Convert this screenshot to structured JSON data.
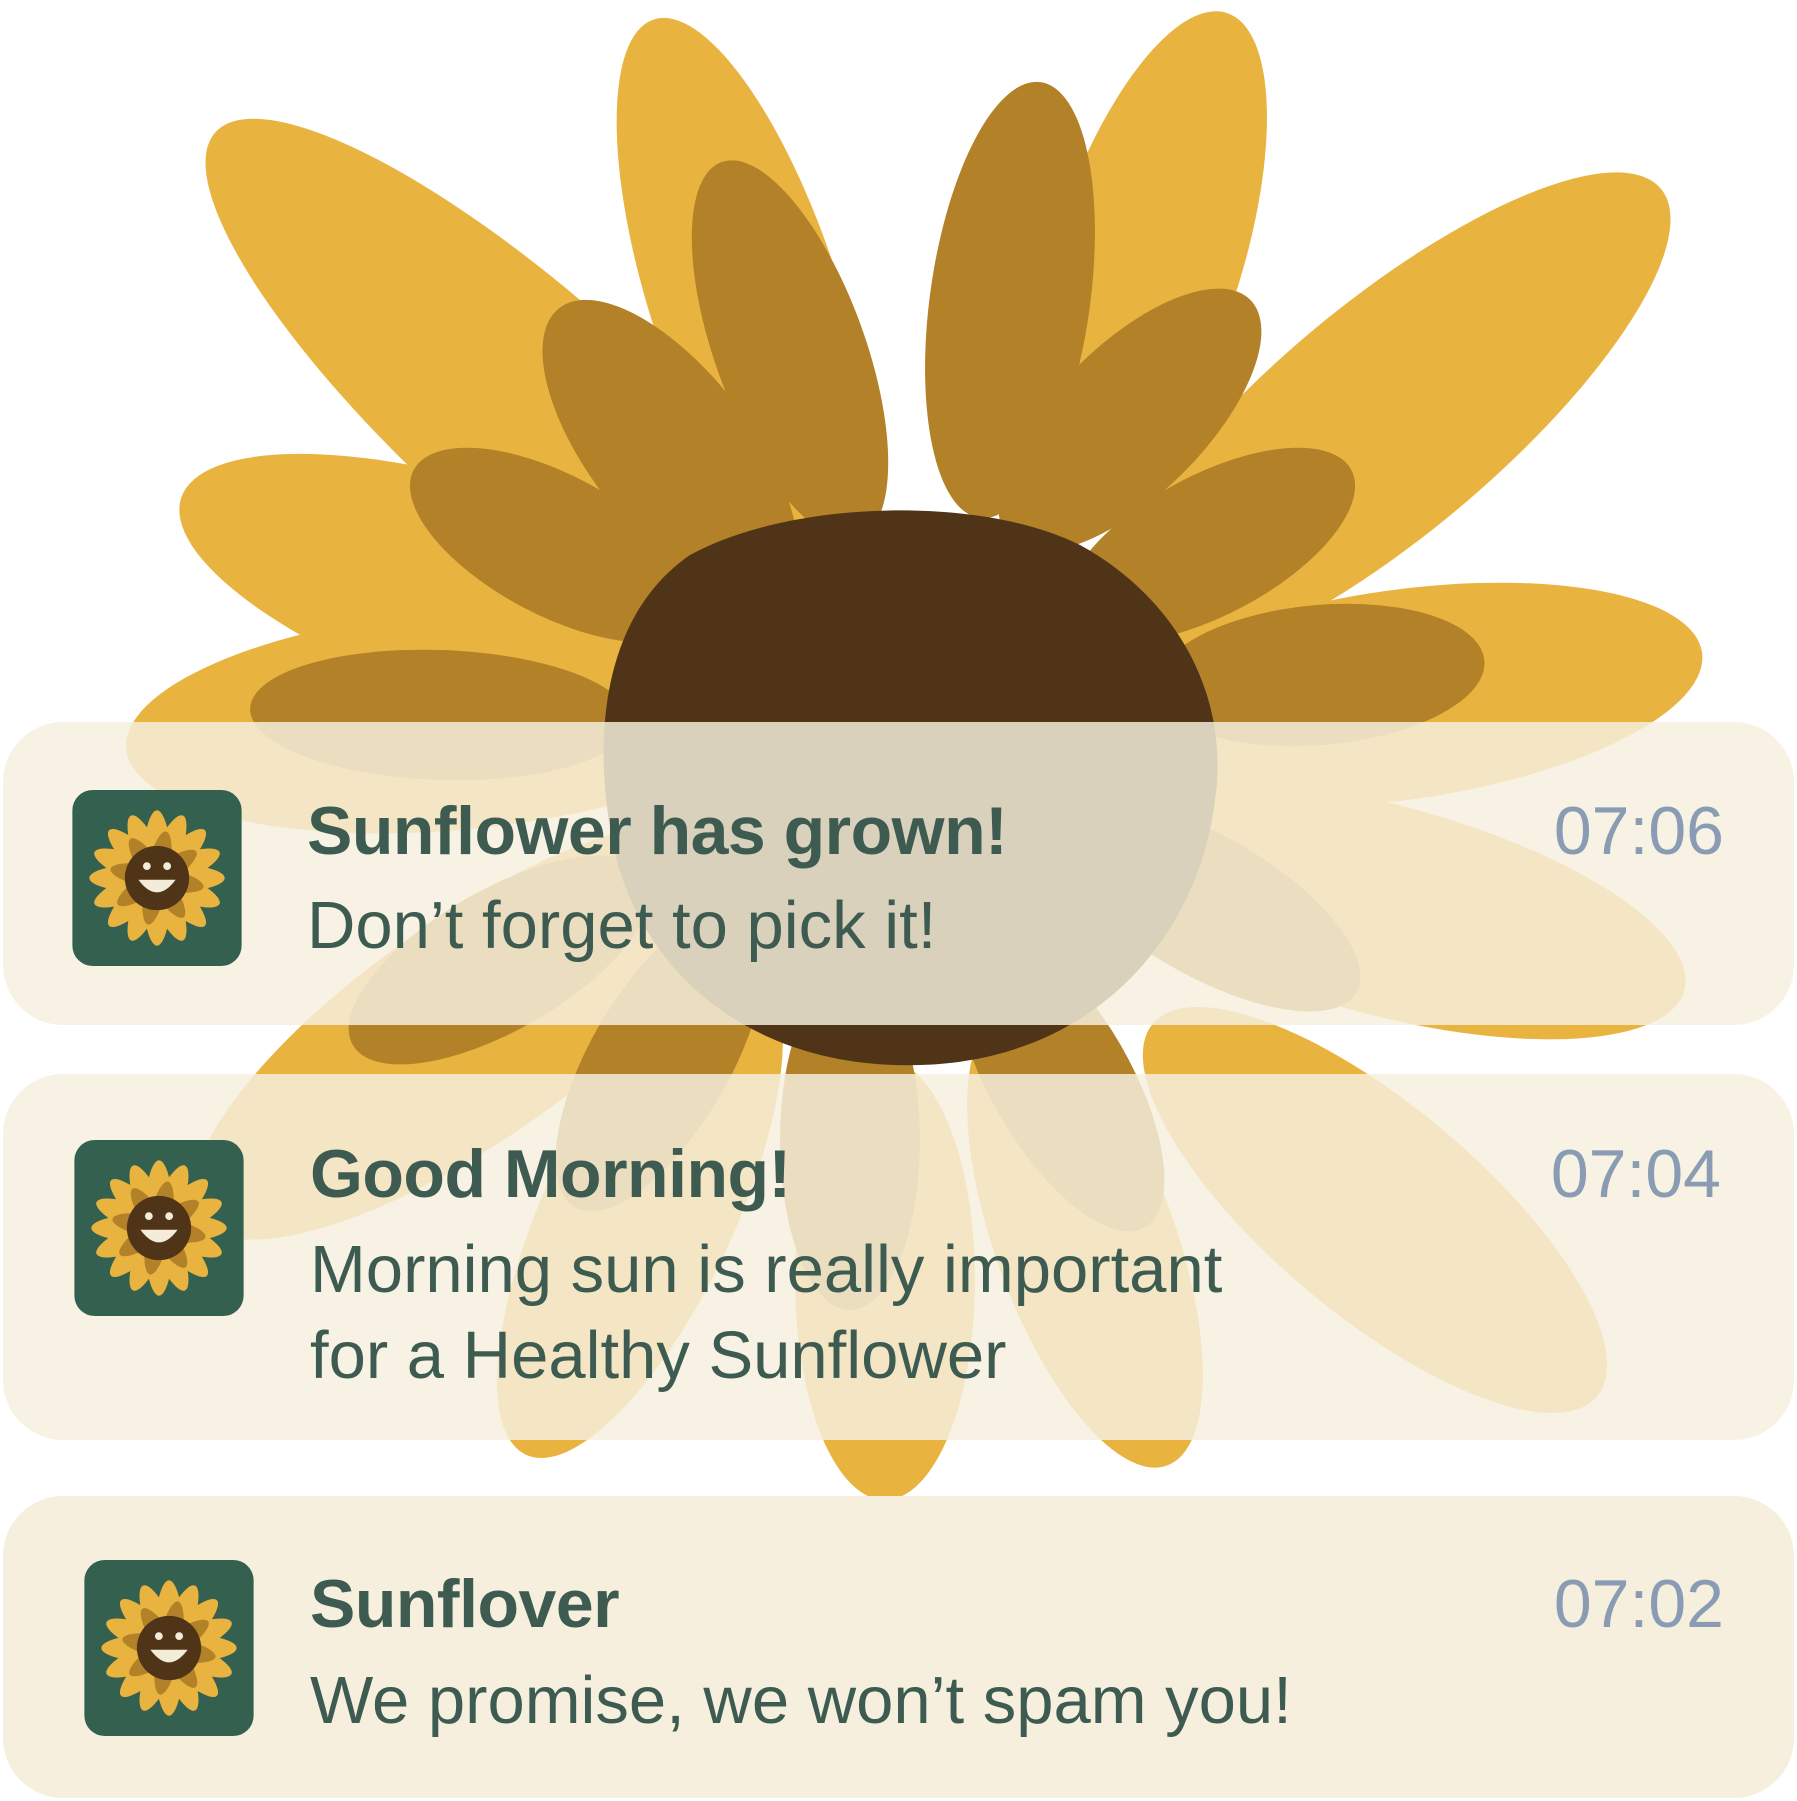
{
  "colors": {
    "petal_light": "#e9b340",
    "petal_dark": "#b38128",
    "center": "#4f3417",
    "card_bg": "#f6efde",
    "title_text": "#3d5b50",
    "time_text": "#8a9cb3",
    "icon_bg": "#33604f"
  },
  "notifications": [
    {
      "icon": "sunflower-app-icon",
      "title": "Sunflower has grown!",
      "body": "Don’t forget to pick it!",
      "time": "07:06"
    },
    {
      "icon": "sunflower-app-icon",
      "title": "Good Morning!",
      "body_line1": "Morning sun is really important",
      "body_line2": "for a Healthy Sunflower",
      "time": "07:04"
    },
    {
      "icon": "sunflower-app-icon",
      "title": "Sunflover",
      "body": "We promise, we won’t spam you!",
      "time": "07:02"
    }
  ]
}
